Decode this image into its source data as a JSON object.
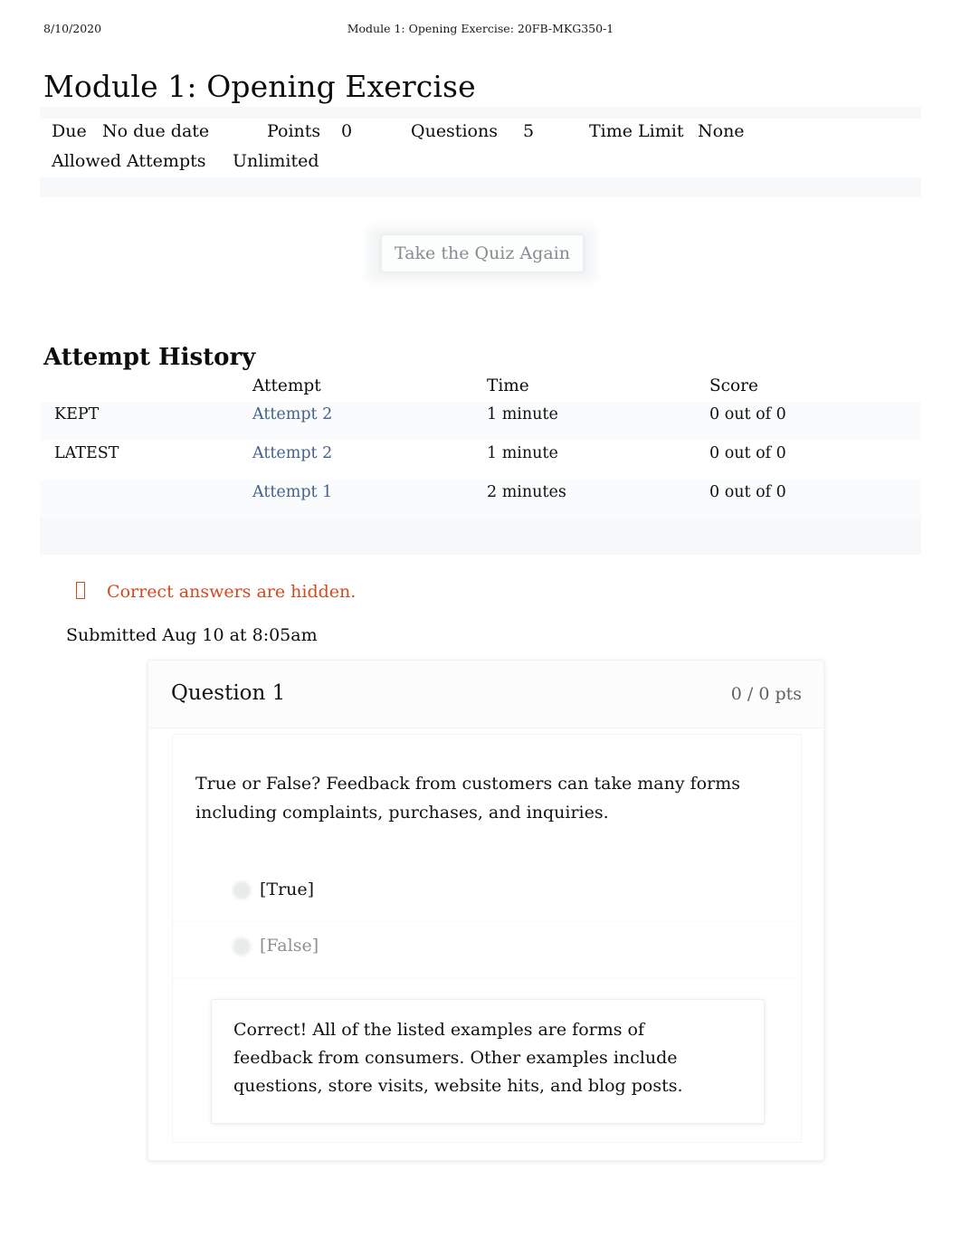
{
  "print_header": {
    "date": "8/10/2020",
    "document_title": "Module 1: Opening Exercise: 20FB-MKG350-1"
  },
  "page_title": "Module 1: Opening Exercise",
  "quiz_meta": {
    "due_label": "Due",
    "due_value": "No due date",
    "points_label": "Points",
    "points_value": "0",
    "questions_label": "Questions",
    "questions_value": "5",
    "time_limit_label": "Time Limit",
    "time_limit_value": "None",
    "allowed_attempts_label": "Allowed Attempts",
    "allowed_attempts_value": "Unlimited"
  },
  "actions": {
    "take_quiz_again": "Take the Quiz Again"
  },
  "attempt_history": {
    "heading": "Attempt History",
    "columns": {
      "flag": "",
      "attempt": "Attempt",
      "time": "Time",
      "score": "Score"
    },
    "rows": [
      {
        "flag": "KEPT",
        "attempt": "Attempt 2",
        "time": "1 minute",
        "score": "0 out of 0"
      },
      {
        "flag": "LATEST",
        "attempt": "Attempt 2",
        "time": "1 minute",
        "score": "0 out of 0"
      },
      {
        "flag": "",
        "attempt": "Attempt 1",
        "time": "2 minutes",
        "score": "0 out of 0"
      }
    ]
  },
  "notice": {
    "icon": "warning-box-icon",
    "text": "Correct answers are hidden.",
    "color": "#d5481f"
  },
  "submitted": "Submitted Aug 10 at 8:05am",
  "question": {
    "title": "Question 1",
    "points": "0 / 0 pts",
    "prompt": "True or False? Feedback from customers can take many forms including complaints, purchases, and inquiries.",
    "answers": [
      {
        "label": "[True]",
        "state": "selected"
      },
      {
        "label": "[False]",
        "state": "unselected"
      }
    ],
    "feedback": "Correct! All of the listed examples are forms of feedback from consumers. Other examples include questions, store visits, website hits, and blog posts."
  },
  "colors": {
    "link": "#44638a",
    "notice": "#d5481f",
    "muted": "#8d9194",
    "band": "#f7f8f9"
  }
}
